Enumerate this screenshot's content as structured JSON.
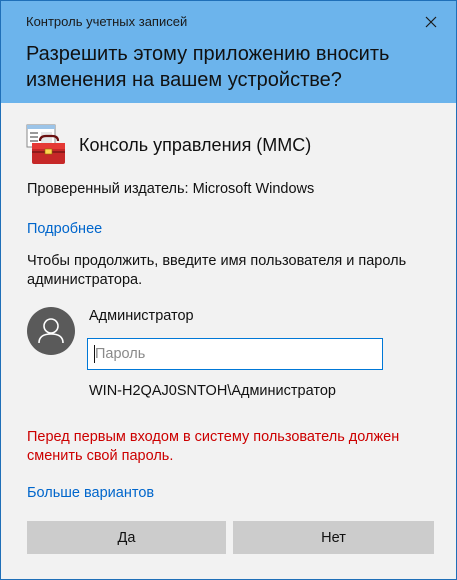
{
  "window": {
    "title": "Контроль учетных записей",
    "headline": "Разрешить этому приложению вносить изменения на вашем устройстве?",
    "close_icon": "close-icon",
    "header_color": "#6cb4ec"
  },
  "app": {
    "name": "Консоль управления (MMC)",
    "icon": "toolbox-icon",
    "publisher": "Проверенный издатель: Microsoft Windows",
    "details_link": "Подробнее"
  },
  "credentials": {
    "instruction": "Чтобы продолжить, введите имя пользователя и пароль администратора.",
    "avatar_icon": "user-avatar-icon",
    "username": "Администратор",
    "password_placeholder": "Пароль",
    "password_value": "",
    "domain_user": "WIN-H2QAJ0SNTOH\\Администратор"
  },
  "warning": {
    "text": "Перед первым входом в систему пользователь должен сменить свой пароль.",
    "color": "#cc0000"
  },
  "more_options": "Больше вариантов",
  "buttons": {
    "yes": "Да",
    "no": "Нет"
  },
  "colors": {
    "link": "#0066cc",
    "focus_border": "#0078d7",
    "button_bg": "#cccccc"
  }
}
